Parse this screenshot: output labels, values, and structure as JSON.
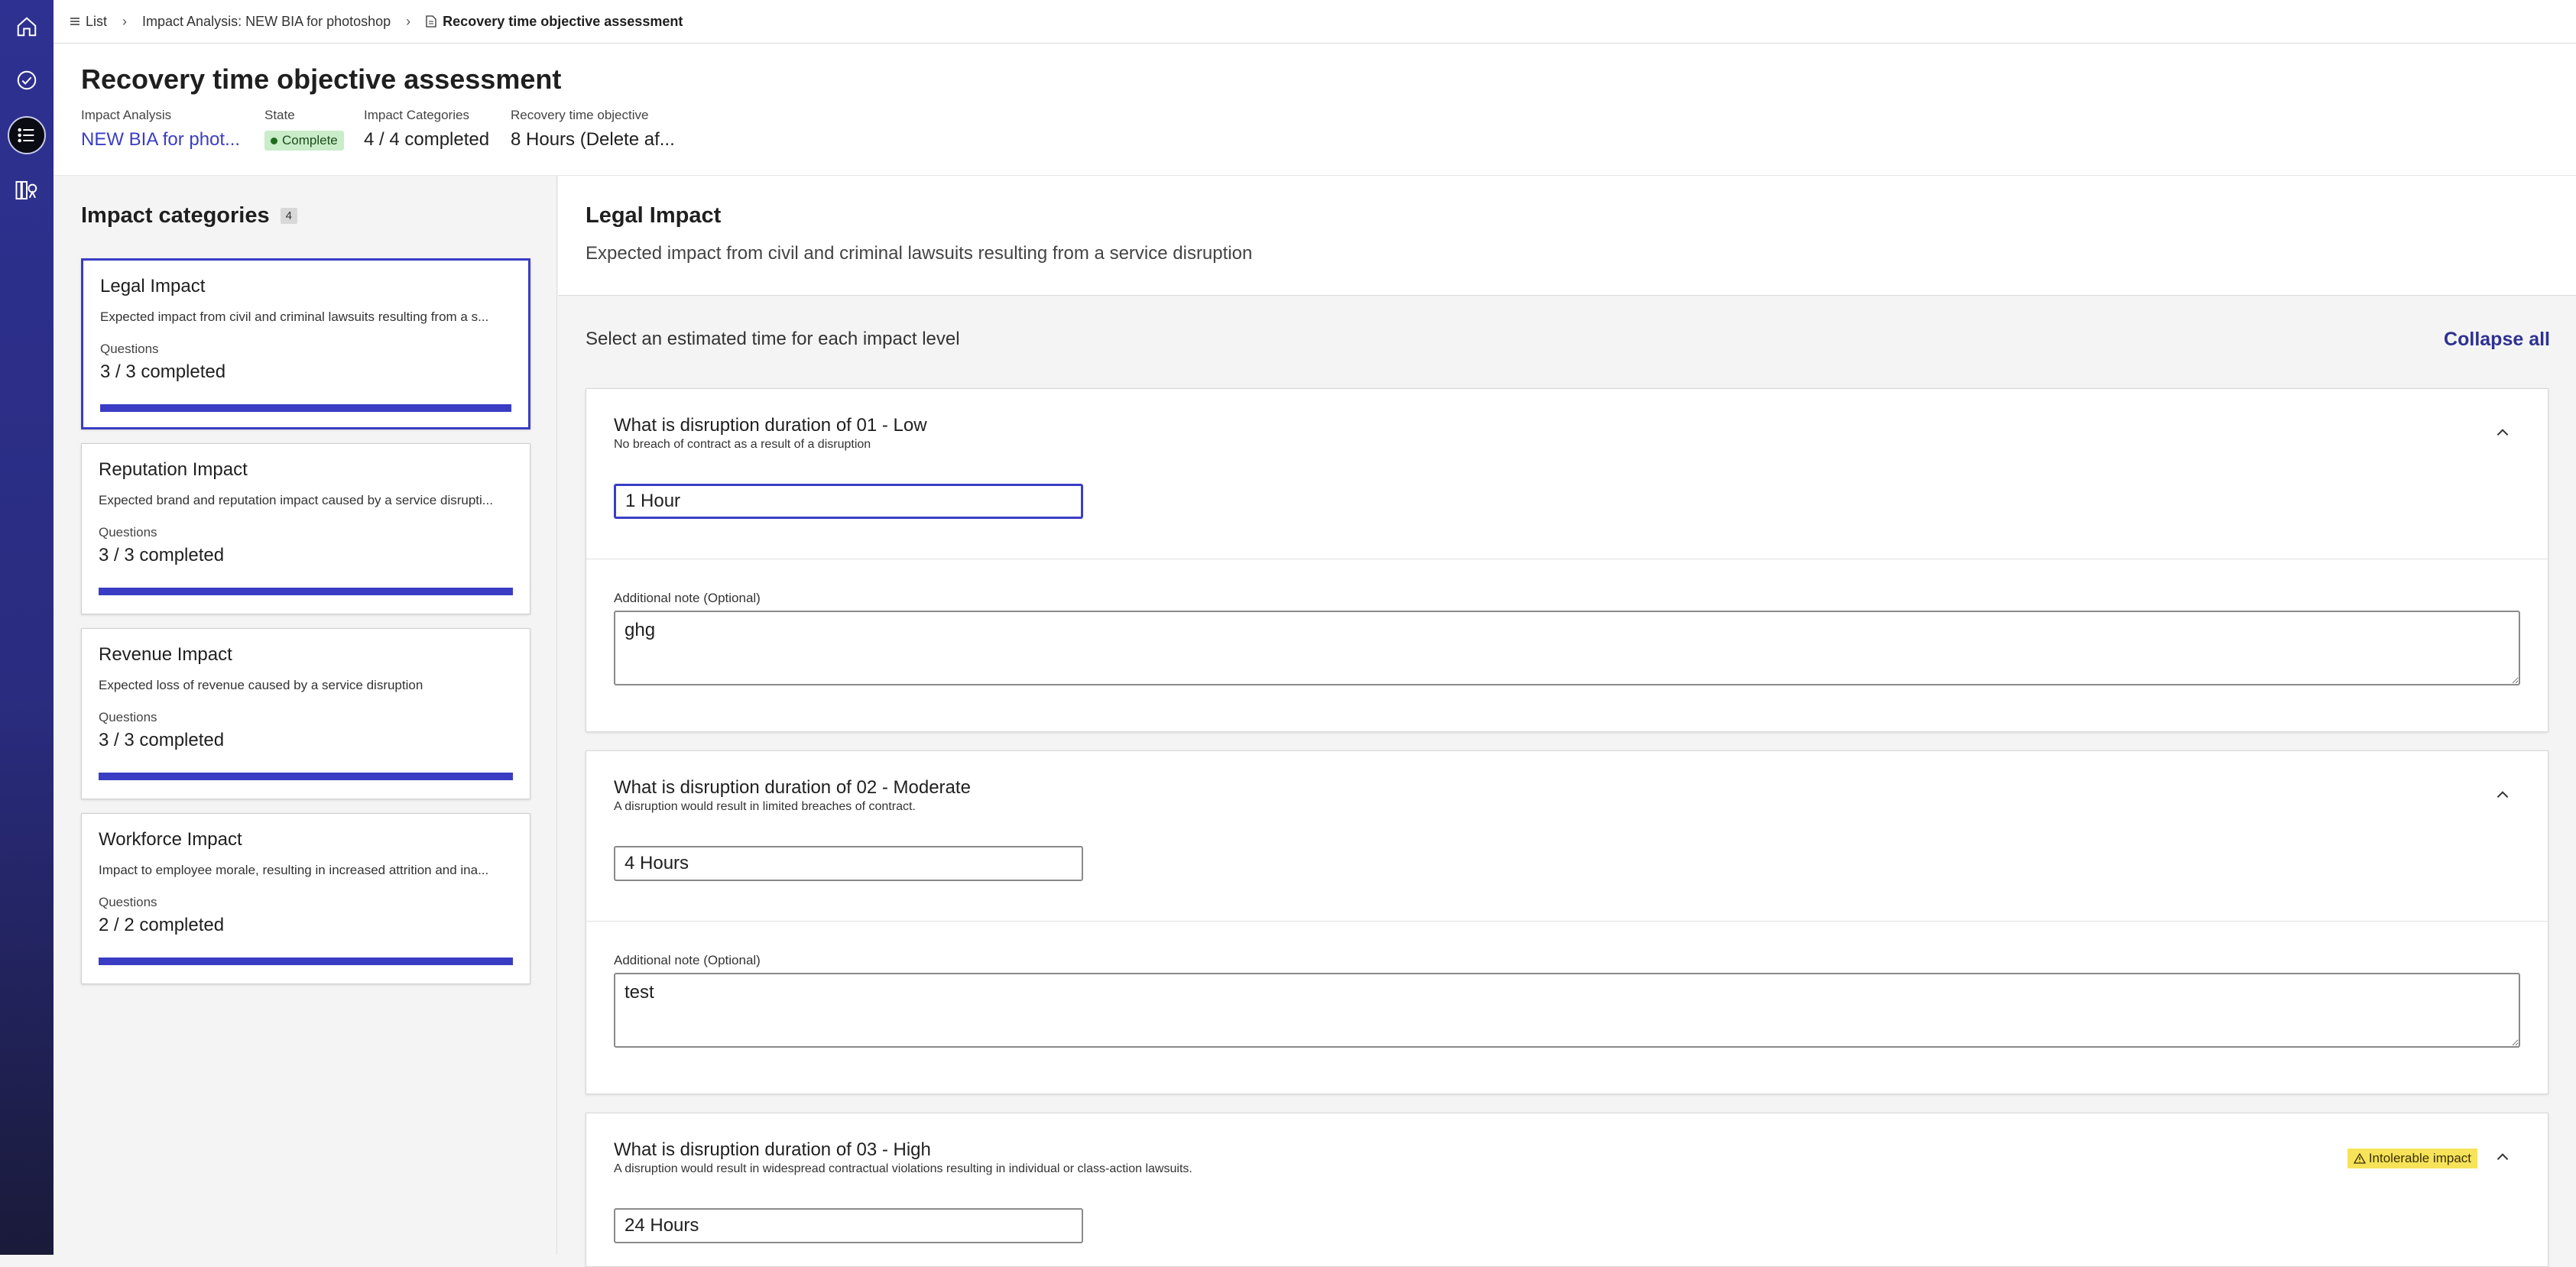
{
  "breadcrumb": {
    "list": "List",
    "impact_analysis": "Impact Analysis: NEW BIA for photoshop",
    "current": "Recovery time objective assessment"
  },
  "header": {
    "title": "Recovery time objective assessment",
    "meta": {
      "impact_analysis": {
        "label": "Impact Analysis",
        "value": "NEW BIA for phot..."
      },
      "state": {
        "label": "State",
        "value": "Complete"
      },
      "impact_categories": {
        "label": "Impact Categories",
        "value": "4 / 4 completed"
      },
      "rto": {
        "label": "Recovery time objective",
        "value": "8 Hours (Delete af..."
      }
    }
  },
  "categories_panel": {
    "title": "Impact categories",
    "count": "4",
    "cards": [
      {
        "title": "Legal Impact",
        "desc": "Expected impact from civil and criminal lawsuits resulting from a s...",
        "questions_label": "Questions",
        "completed": "3 / 3 completed",
        "progress": 1.0
      },
      {
        "title": "Reputation Impact",
        "desc": "Expected brand and reputation impact caused by a service disrupti...",
        "questions_label": "Questions",
        "completed": "3 / 3 completed",
        "progress": 1.0
      },
      {
        "title": "Revenue Impact",
        "desc": "Expected loss of revenue caused by a service disruption",
        "questions_label": "Questions",
        "completed": "3 / 3 completed",
        "progress": 1.0
      },
      {
        "title": "Workforce Impact",
        "desc": "Impact to employee morale, resulting in increased attrition and ina...",
        "questions_label": "Questions",
        "completed": "2 / 2 completed",
        "progress": 1.0
      }
    ]
  },
  "detail": {
    "title": "Legal Impact",
    "desc": "Expected impact from civil and criminal lawsuits resulting from a service disruption",
    "instruction": "Select an estimated time for each impact level",
    "collapse_all": "Collapse all",
    "note_label": "Additional note (Optional)",
    "questions": [
      {
        "title": "What is disruption duration of 01 - Low",
        "subtitle": "No breach of contract as a result of a disruption",
        "value": "1 Hour",
        "note": "ghg"
      },
      {
        "title": "What is disruption duration of 02 - Moderate",
        "subtitle": "A disruption would result in limited breaches of contract.",
        "value": "4 Hours",
        "note": "test"
      },
      {
        "title": "What is disruption duration of 03 - High",
        "subtitle": "A disruption would result in widespread contractual violations resulting in individual or class-action lawsuits.",
        "value": "24 Hours",
        "warning": "Intolerable impact"
      }
    ]
  },
  "colors": {
    "accent": "#3a3dc4",
    "rail": "#2e3191",
    "warning": "#f7e35a",
    "state_bg": "#c9ecc9"
  }
}
